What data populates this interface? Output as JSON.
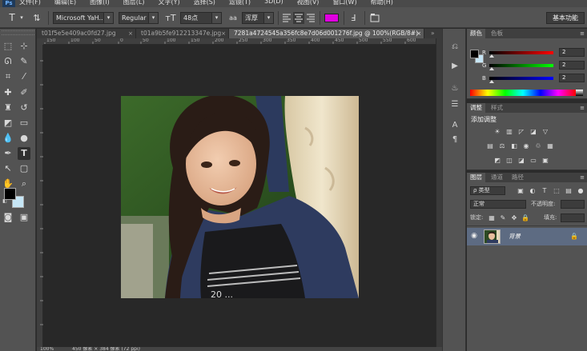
{
  "menu": {
    "logo": "Ps",
    "items": [
      "文件(F)",
      "编辑(E)",
      "图像(I)",
      "图层(L)",
      "文字(Y)",
      "选择(S)",
      "滤镜(T)",
      "3D(D)",
      "视图(V)",
      "窗口(W)",
      "帮助(H)"
    ]
  },
  "options": {
    "tool_glyph": "T",
    "font_family": "Microsoft YaH...",
    "font_style": "Regular",
    "font_size": "48点",
    "aa_icon": "aa",
    "aa_mode": "浑厚",
    "text_color": "#e000e0",
    "workspace": "基本功能"
  },
  "tabs": [
    {
      "label": "t01f5e5e409ac0fd27.jpg",
      "close": "×"
    },
    {
      "label": "t01a9b5fe912213347e.jpg",
      "close": "×"
    },
    {
      "label": "7281a4724545a356fc8e7d06d001276f.jpg @ 100%(RGB/8#)",
      "close": "×"
    }
  ],
  "ruler_top": [
    "150",
    "100",
    "50",
    "0",
    "50",
    "100",
    "150",
    "200",
    "250",
    "300",
    "350",
    "400",
    "450",
    "500",
    "550",
    "600"
  ],
  "status": {
    "zoom": "100%",
    "info": "450 像素 × 384 像素 (72 ppi)"
  },
  "colors": {
    "foreground": "#000000",
    "background": "#c6e6f6"
  },
  "color_panel": {
    "tabs": [
      "颜色",
      "色板"
    ],
    "rows": [
      {
        "label": "R",
        "value": "2"
      },
      {
        "label": "G",
        "value": "2"
      },
      {
        "label": "B",
        "value": "2"
      }
    ]
  },
  "adjust_panel": {
    "tabs": [
      "调整",
      "样式"
    ],
    "title": "添加调整"
  },
  "layers_panel": {
    "tabs": [
      "图层",
      "通道",
      "路径"
    ],
    "kind_filter": "ρ 类型",
    "blend_mode": "正常",
    "opacity_label": "不透明度:",
    "lock_label": "锁定:",
    "fill_label": "填充:",
    "layer_name": "背景"
  }
}
